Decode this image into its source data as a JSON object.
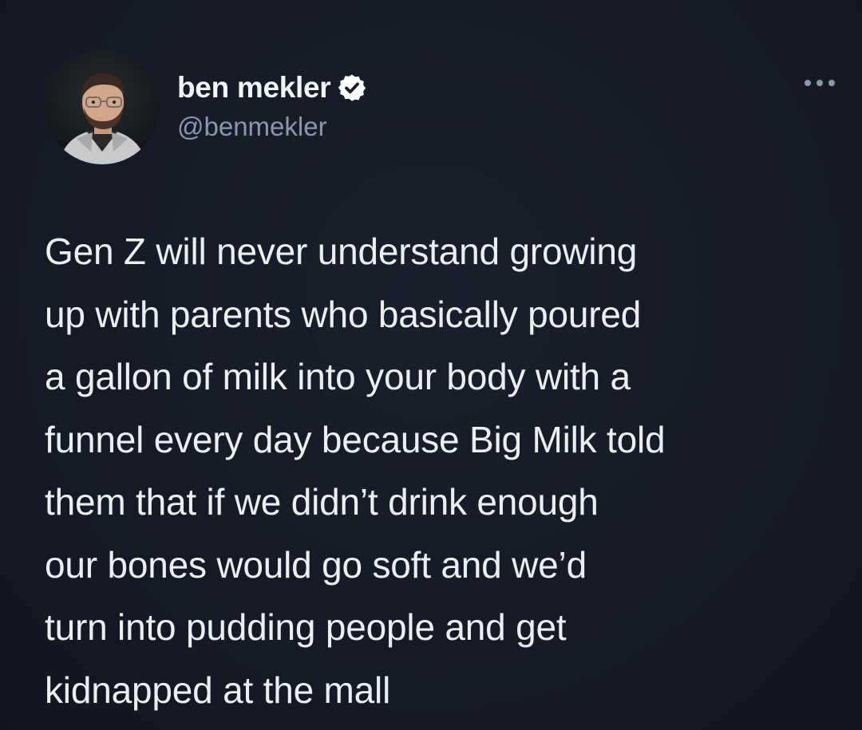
{
  "author": {
    "display_name": "ben mekler",
    "handle": "@benmekler",
    "verified": true,
    "avatar_icon": "person-with-glasses-avatar",
    "verified_icon": "verified-badge-icon"
  },
  "actions": {
    "more_icon": "more-options-icon"
  },
  "tweet": {
    "text": "Gen Z will never understand growing\nup with parents who basically poured\na gallon of milk into your body with a\nfunnel every day because Big Milk told\nthem that if we didn’t drink enough\nour bones would go soft and we’d\nturn into pudding people and get\nkidnapped at the mall"
  },
  "colors": {
    "background": "#151a26",
    "text": "#eceeef",
    "handle": "#8b98a5",
    "verified_badge": "#ffffff"
  }
}
